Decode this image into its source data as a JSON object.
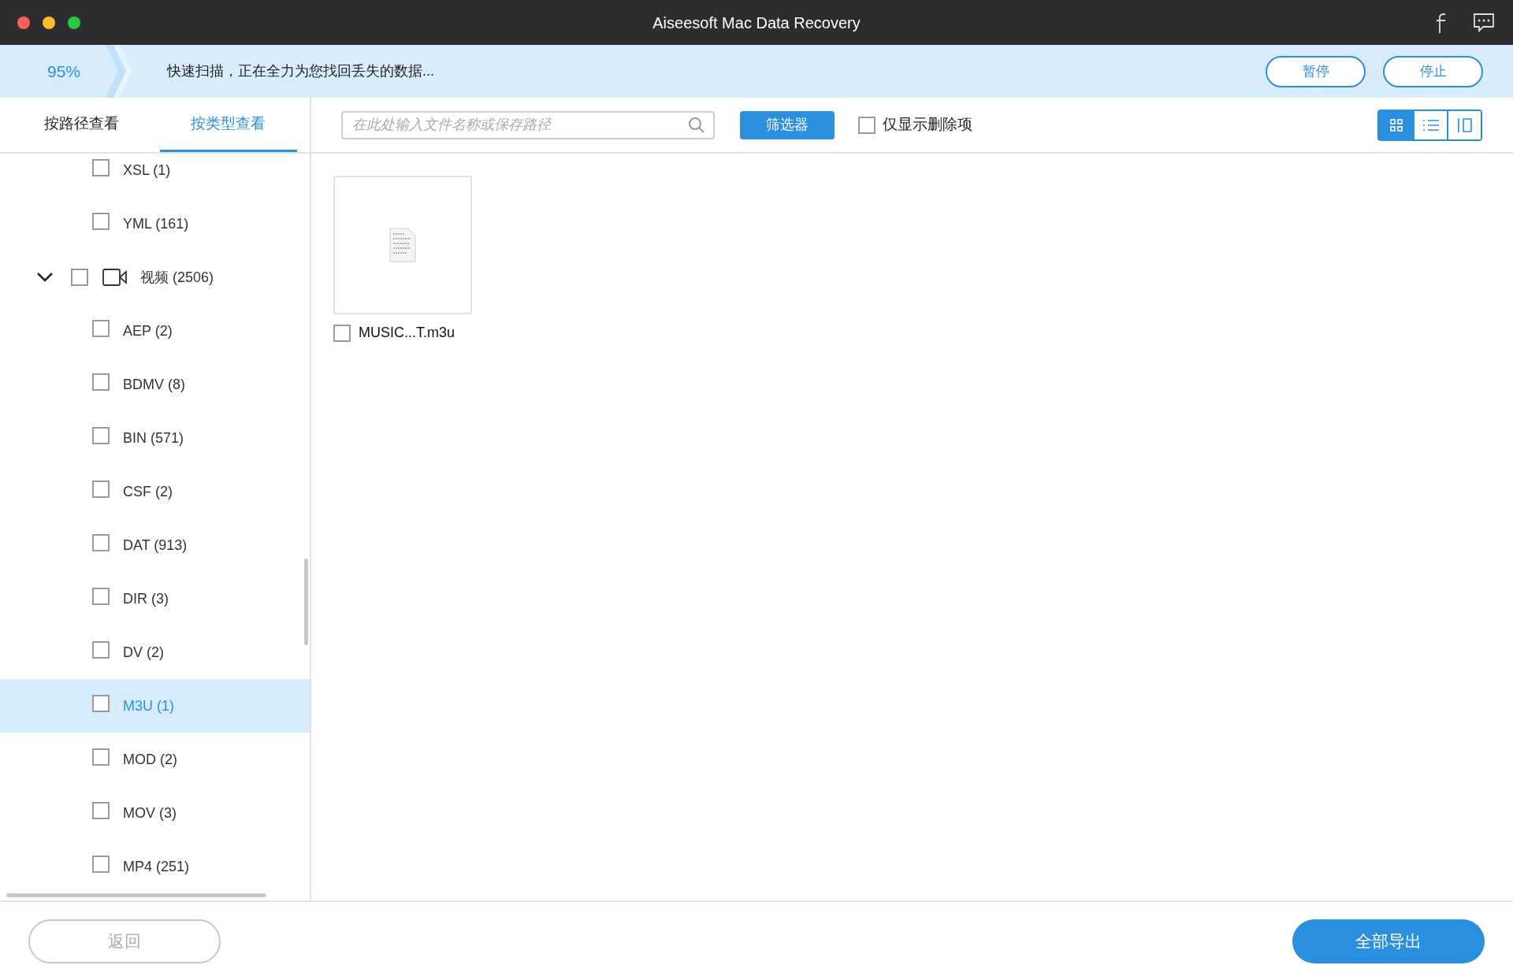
{
  "window": {
    "title": "Aiseesoft Mac Data Recovery"
  },
  "scan": {
    "percent": "95%",
    "message": "快速扫描，正在全力为您找回丢失的数据...",
    "buttons": [
      "暂停",
      "停止"
    ]
  },
  "side_tabs": [
    {
      "label": "按路径查看",
      "selected": false
    },
    {
      "label": "按类型查看",
      "selected": true
    }
  ],
  "sidebar": {
    "items": [
      {
        "label": "XSL (1)",
        "checked": false,
        "selected": false
      },
      {
        "label": "YML (161)",
        "checked": false,
        "selected": false
      },
      {
        "label": "视频 (2506)",
        "checked": false,
        "selected": false,
        "expanded": true,
        "children": [
          {
            "label": "AEP (2)",
            "checked": false,
            "selected": false
          },
          {
            "label": "BDMV (8)",
            "checked": false,
            "selected": false
          },
          {
            "label": "BIN (571)",
            "checked": false,
            "selected": false
          },
          {
            "label": "CSF (2)",
            "checked": false,
            "selected": false
          },
          {
            "label": "DAT (913)",
            "checked": false,
            "selected": false
          },
          {
            "label": "DIR (3)",
            "checked": false,
            "selected": false
          },
          {
            "label": "DV (2)",
            "checked": false,
            "selected": false
          },
          {
            "label": "M3U (1)",
            "checked": false,
            "selected": true
          },
          {
            "label": "MOD (2)",
            "checked": false,
            "selected": false
          },
          {
            "label": "MOV (3)",
            "checked": false,
            "selected": false
          },
          {
            "label": "MP4 (251)",
            "checked": false,
            "selected": false
          }
        ]
      }
    ]
  },
  "toolbar": {
    "search_placeholder": "在此处输入文件名称或保存路径",
    "filter_button": "筛选器",
    "deleted_only": {
      "label": "仅显示删除项",
      "checked": false
    },
    "views": [
      {
        "kind": "grid",
        "selected": true
      },
      {
        "kind": "list",
        "selected": false
      },
      {
        "kind": "detail",
        "selected": false
      }
    ]
  },
  "files": [
    {
      "name": "MUSIC...T.m3u",
      "checked": false
    }
  ],
  "footer": {
    "back_button": "返回",
    "export_button": "全部导出"
  }
}
